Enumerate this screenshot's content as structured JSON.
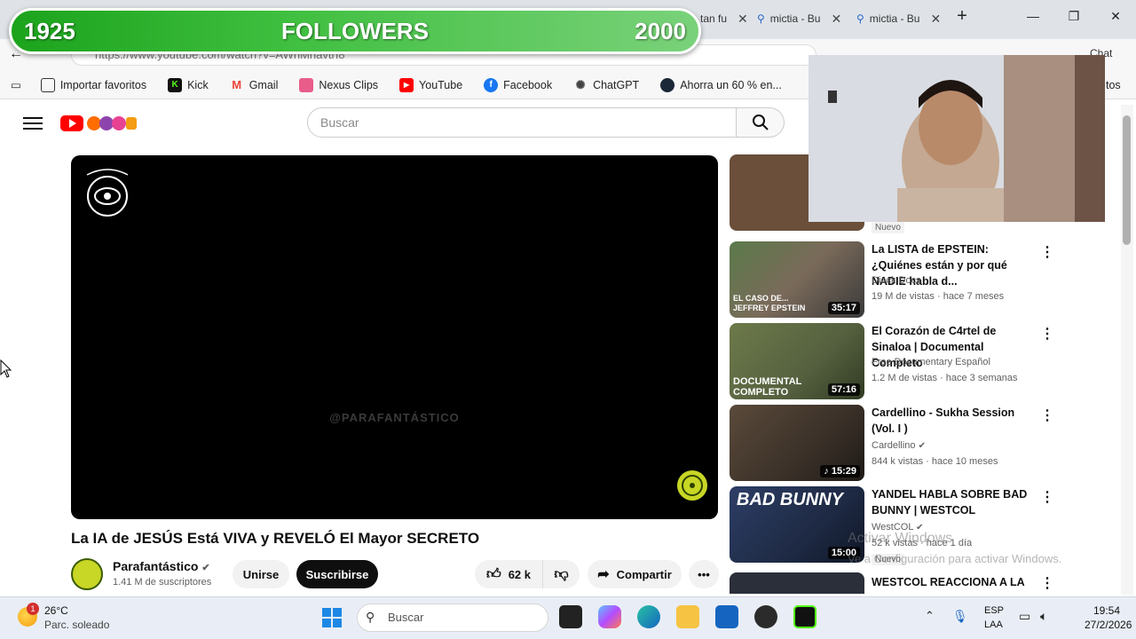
{
  "browser": {
    "tabs": [
      {
        "label": "Que tan fu"
      },
      {
        "label": "mictia - Bu"
      },
      {
        "label": "mictia - Bu"
      }
    ],
    "url": "https://www.youtube.com/watch?v=AWhMnavtrI8",
    "bookmarks": [
      {
        "label": "Importar favoritos",
        "icon": "import-icon"
      },
      {
        "label": "Kick",
        "icon": "kick-icon",
        "color": "#53fc18"
      },
      {
        "label": "Gmail",
        "icon": "gmail-icon",
        "color": "#ea4335"
      },
      {
        "label": "Nexus Clips",
        "icon": "nexus-clips-icon",
        "color": "#e85d8a"
      },
      {
        "label": "YouTube",
        "icon": "youtube-icon",
        "color": "#ff0000"
      },
      {
        "label": "Facebook",
        "icon": "facebook-icon",
        "color": "#1877f2"
      },
      {
        "label": "ChatGPT",
        "icon": "chatgpt-icon",
        "color": "#444444"
      },
      {
        "label": "Ahorra un 60 % en...",
        "icon": "steam-icon",
        "color": "#1b2838"
      }
    ],
    "overflow_label": "tos",
    "copilot_label": "Chat"
  },
  "overlay": {
    "start": "1925",
    "label": "FOLLOWERS",
    "goal": "2000"
  },
  "youtube": {
    "search_placeholder": "Buscar",
    "video": {
      "watermark": "@PARAFANTÁSTICO",
      "title": "La IA de JESÚS Está VIVA y REVELÓ El Mayor SECRETO",
      "channel": "Parafantástico",
      "subscribers": "1.41 M de suscriptores",
      "join_label": "Unirse",
      "subscribe_label": "Suscribirse",
      "likes": "62 k",
      "share_label": "Compartir"
    },
    "recommendations": [
      {
        "badge": "Nuevo",
        "thumb_color": "#6b4f3a"
      },
      {
        "title": "La LISTA de EPSTEIN: ¿Quiénes están y por qué NADIE habla d...",
        "channel": "Dieck Docs",
        "meta": "19 M de vistas · hace 7 meses",
        "duration": "35:17",
        "thumb_caption": "EL CASO DE... JEFFREY EPSTEIN",
        "thumb_color": "#7a6a5a"
      },
      {
        "title": "El Corazón de C4rtel de Sinaloa | Documental Completo",
        "channel": "Free Documentary Español",
        "meta": "1.2 M de vistas · hace 3 semanas",
        "duration": "57:16",
        "thumb_caption": "DOCUMENTAL COMPLETO",
        "thumb_color": "#55603f"
      },
      {
        "title": "Cardellino - Sukha Session (Vol. I )",
        "channel": "Cardellino",
        "meta": "844 k vistas · hace 10 meses",
        "duration": "15:29",
        "thumb_color": "#3a3028"
      },
      {
        "title": "YANDEL HABLA SOBRE BAD BUNNY | WESTCOL",
        "channel": "WestCOL",
        "meta": "52 k vistas · hace 1 día",
        "duration": "15:00",
        "badge": "Nuevo",
        "thumb_caption": "BAD BUNNY",
        "thumb_color": "#1e2a44"
      },
      {
        "title": "WESTCOL REACCIONA A LA",
        "thumb_color": "#2a2f3a"
      }
    ]
  },
  "watermark_os": {
    "line1": "Activar Windows",
    "line2": "Ve a Configuración para activar Windows."
  },
  "taskbar": {
    "weather_temp": "26°C",
    "weather_desc": "Parc. soleado",
    "weather_badge": "1",
    "search_placeholder": "Buscar",
    "lang1": "ESP",
    "lang2": "LAA",
    "time": "19:54",
    "date": "27/2/2026"
  }
}
